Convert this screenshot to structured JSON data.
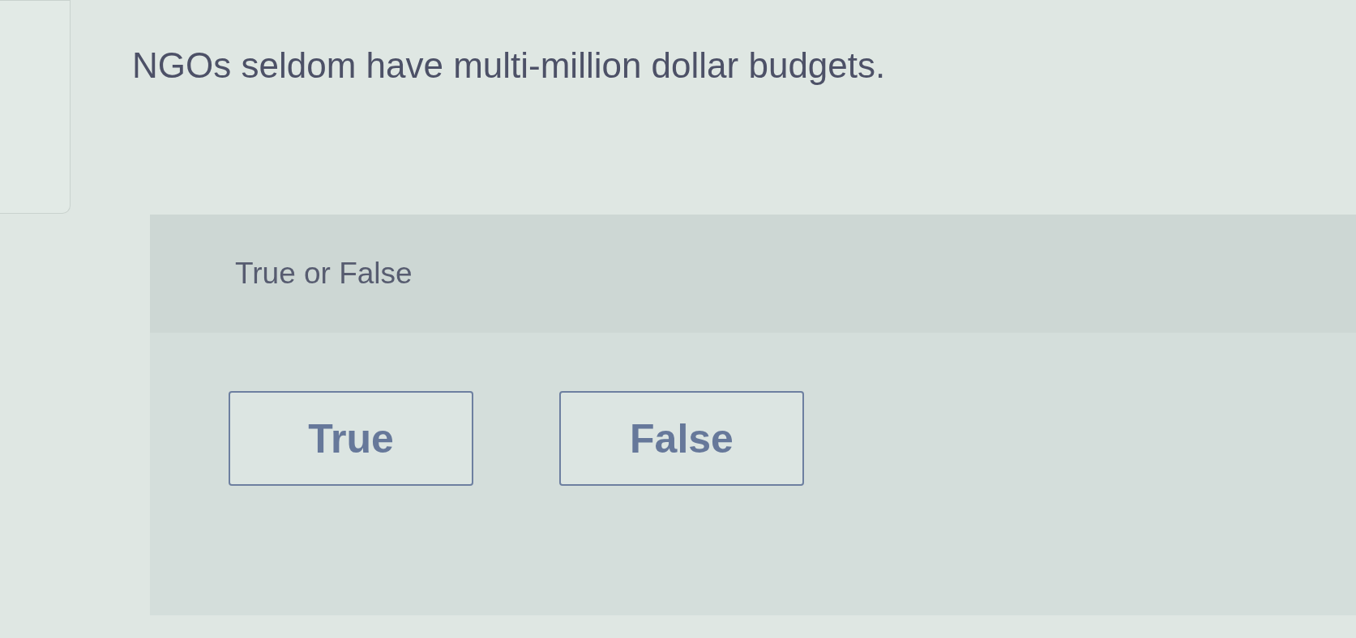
{
  "question": {
    "text": "NGOs seldom have multi-million dollar budgets."
  },
  "answer_panel": {
    "prompt": "True or False",
    "options": [
      {
        "label": "True",
        "selected": false
      },
      {
        "label": "False",
        "selected": false
      }
    ]
  }
}
